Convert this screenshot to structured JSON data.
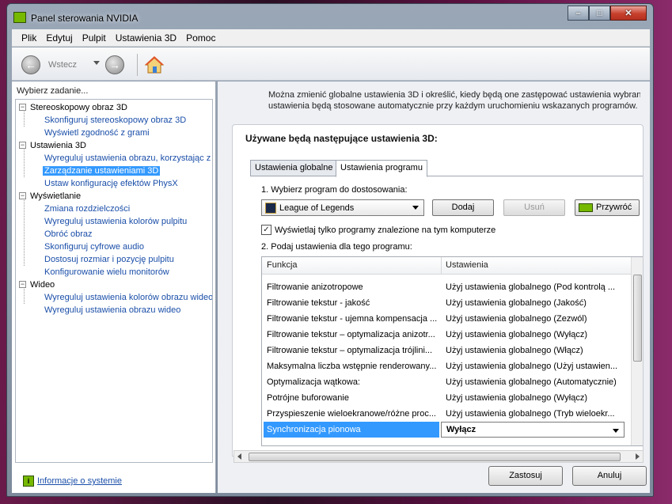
{
  "window": {
    "title": "Panel sterowania NVIDIA",
    "caption_buttons": {
      "minimize": "–",
      "maximize": "□",
      "close": "✕"
    }
  },
  "menu": [
    "Plik",
    "Edytuj",
    "Pulpit",
    "Ustawienia 3D",
    "Pomoc"
  ],
  "toolbar": {
    "back_label": "Wstecz",
    "back_icon": "back-arrow-icon",
    "forward_icon": "forward-arrow-icon",
    "home_icon": "home-icon"
  },
  "left": {
    "header": "Wybierz zadanie...",
    "tree": [
      {
        "label": "Stereoskopowy obraz 3D",
        "type": "category",
        "toggle": "−"
      },
      {
        "label": "Skonfiguruj stereoskopowy obraz 3D",
        "type": "link"
      },
      {
        "label": "Wyświetl zgodność z grami",
        "type": "link"
      },
      {
        "label": "Ustawienia 3D",
        "type": "category",
        "toggle": "−"
      },
      {
        "label": "Wyreguluj ustawienia obrazu, korzystając z",
        "type": "link"
      },
      {
        "label": "Zarządzanie ustawieniami 3D",
        "type": "link",
        "selected": true
      },
      {
        "label": "Ustaw konfigurację efektów PhysX",
        "type": "link"
      },
      {
        "label": "Wyświetlanie",
        "type": "category",
        "toggle": "−"
      },
      {
        "label": "Zmiana rozdzielczości",
        "type": "link"
      },
      {
        "label": "Wyreguluj ustawienia kolorów pulpitu",
        "type": "link"
      },
      {
        "label": "Obróć obraz",
        "type": "link"
      },
      {
        "label": "Skonfiguruj cyfrowe audio",
        "type": "link"
      },
      {
        "label": "Dostosuj rozmiar i pozycję pulpitu",
        "type": "link"
      },
      {
        "label": "Konfigurowanie wielu monitorów",
        "type": "link"
      },
      {
        "label": "Wideo",
        "type": "category",
        "toggle": "−"
      },
      {
        "label": "Wyreguluj ustawienia kolorów obrazu wideo",
        "type": "link"
      },
      {
        "label": "Wyreguluj ustawienia obrazu wideo",
        "type": "link"
      }
    ],
    "system_info": "Informacje o systemie"
  },
  "right": {
    "intro_line1": "Można zmienić globalne ustawienia 3D i określić, kiedy będą one zastępować ustawienia wybrany",
    "intro_line2": "ustawienia będą stosowane automatycznie przy każdym uruchomieniu wskazanych programów.",
    "settings_title": "Używane będą następujące ustawienia 3D:",
    "tabs": [
      {
        "label": "Ustawienia globalne",
        "active": false
      },
      {
        "label": "Ustawienia programu",
        "active": true
      }
    ],
    "step1": "1. Wybierz program do dostosowania:",
    "program": "League of Legends",
    "buttons": {
      "add": "Dodaj",
      "remove": "Usuń",
      "restore": "Przywróć"
    },
    "checkbox_label": "Wyświetlaj tylko programy znalezione na tym komputerze",
    "checkbox_checked": "✓",
    "step2": "2. Podaj ustawienia dla tego programu:",
    "grid_headers": {
      "function": "Funkcja",
      "settings": "Ustawienia"
    },
    "rows": [
      {
        "f": "Filtrowanie anizotropowe",
        "v": "Użyj ustawienia globalnego (Pod kontrolą ..."
      },
      {
        "f": "Filtrowanie tekstur - jakość",
        "v": "Użyj ustawienia globalnego (Jakość)"
      },
      {
        "f": "Filtrowanie tekstur - ujemna kompensacja ...",
        "v": "Użyj ustawienia globalnego (Zezwól)"
      },
      {
        "f": "Filtrowanie tekstur – optymalizacja anizotr...",
        "v": "Użyj ustawienia globalnego (Wyłącz)"
      },
      {
        "f": "Filtrowanie tekstur – optymalizacja trójlini...",
        "v": "Użyj ustawienia globalnego (Włącz)"
      },
      {
        "f": "Maksymalna liczba wstępnie renderowany...",
        "v": "Użyj ustawienia globalnego (Użyj ustawien..."
      },
      {
        "f": "Optymalizacja wątkowa:",
        "v": "Użyj ustawienia globalnego (Automatycznie)"
      },
      {
        "f": "Potrójne buforowanie",
        "v": "Użyj ustawienia globalnego (Wyłącz)"
      },
      {
        "f": "Przyspieszenie wieloekranowe/różne proc...",
        "v": "Użyj ustawienia globalnego (Tryb wieloekr..."
      },
      {
        "f": "Synchronizacja pionowa",
        "v": "Wyłącz",
        "selected": true
      }
    ],
    "apply": "Zastosuj",
    "cancel": "Anuluj"
  }
}
